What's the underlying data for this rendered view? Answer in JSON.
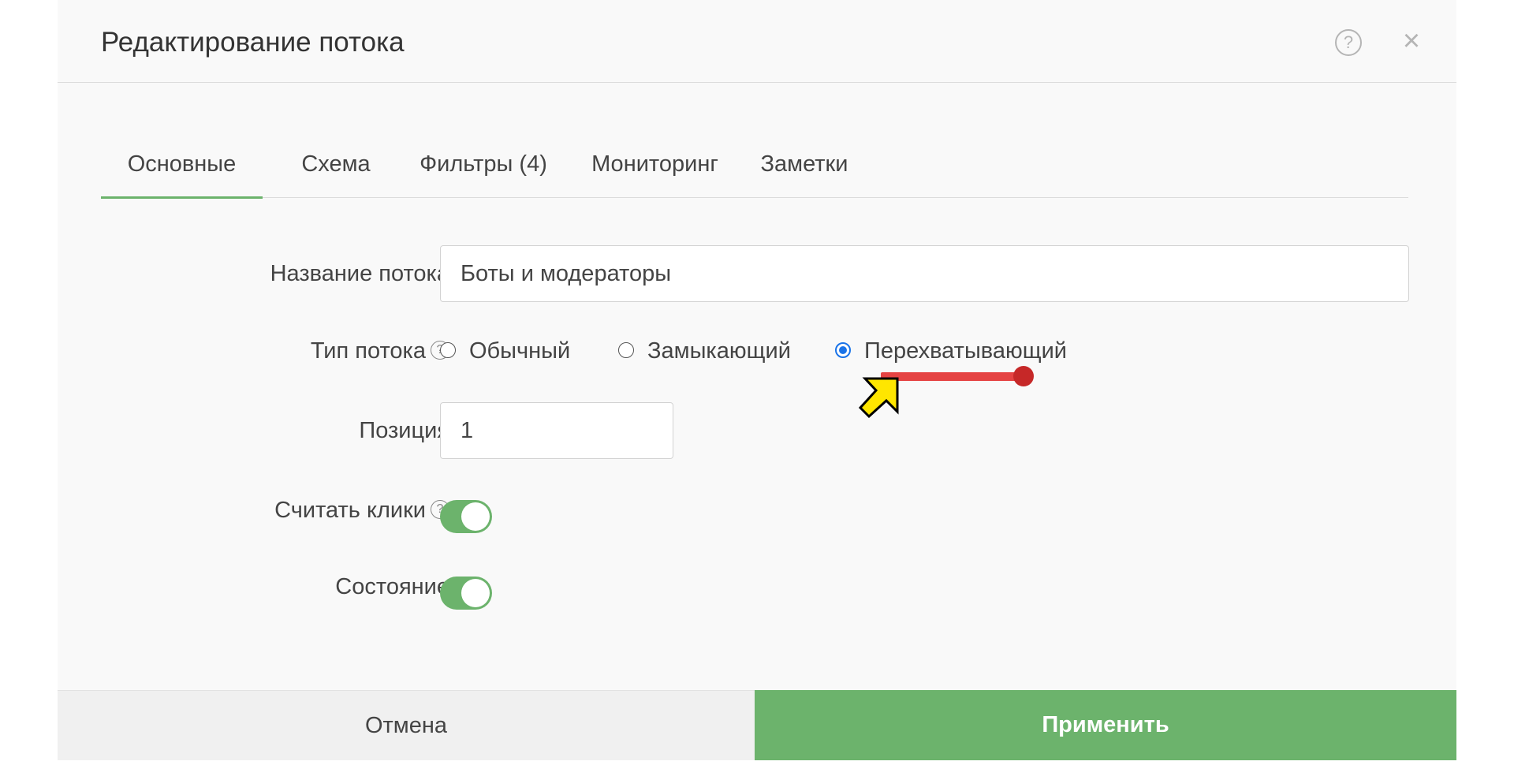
{
  "dialog": {
    "title": "Редактирование потока",
    "help_symbol": "?",
    "close_symbol": "×"
  },
  "tabs": [
    {
      "label": "Основные",
      "active": true
    },
    {
      "label": "Схема",
      "active": false
    },
    {
      "label": "Фильтры (4)",
      "active": false
    },
    {
      "label": "Мониторинг",
      "active": false
    },
    {
      "label": "Заметки",
      "active": false
    }
  ],
  "form": {
    "name": {
      "label": "Название потока",
      "value": "Боты и модераторы"
    },
    "type": {
      "label": "Тип потока",
      "help_symbol": "?",
      "options": [
        {
          "label": "Обычный",
          "checked": false
        },
        {
          "label": "Замыкающий",
          "checked": false
        },
        {
          "label": "Перехватывающий",
          "checked": true
        }
      ]
    },
    "position": {
      "label": "Позиция",
      "value": "1"
    },
    "count_clicks": {
      "label": "Считать клики",
      "help_symbol": "?",
      "enabled": true
    },
    "state": {
      "label": "Состояние",
      "enabled": true
    }
  },
  "footer": {
    "cancel_label": "Отмена",
    "apply_label": "Применить"
  },
  "colors": {
    "accent_green": "#6cb36c",
    "radio_blue": "#1a73e8",
    "annotation_red": "#e54343"
  }
}
